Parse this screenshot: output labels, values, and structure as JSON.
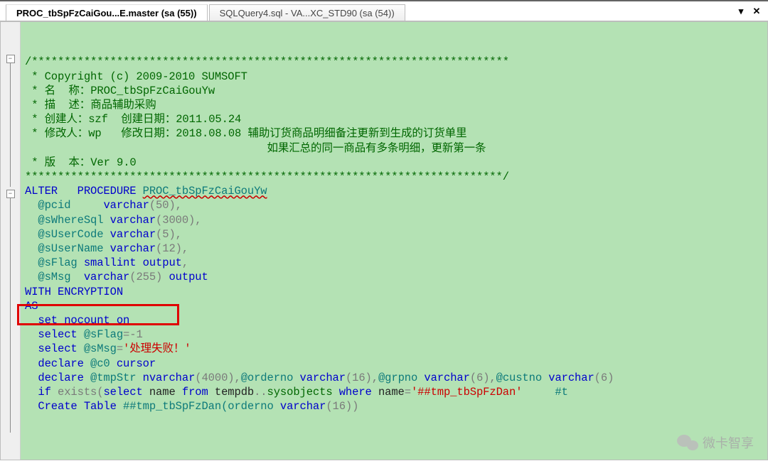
{
  "tabs": {
    "active": "PROC_tbSpFzCaiGou...E.master (sa (55))",
    "inactive": "SQLQuery4.sql - VA...XC_STD90 (sa (54))"
  },
  "winbtns": {
    "pin": "▾",
    "close": "✕"
  },
  "fold": {
    "glyph1": "−",
    "glyph2": "−"
  },
  "code": {
    "l01": "/*************************************************************************",
    "l02a": "* Copyright (c) 2009-2010 SUMSOFT",
    "l03a": "* 名  称：PROC_tbSpFzCaiGouYw",
    "l04a": "* 描  述：商品辅助采购",
    "l05a": "* 创建人：szf  创建日期：2011.05.24",
    "l06a": "* 修改人：wp   修改日期：2018.08.08 辅助订货商品明细备注更新到生成的订货单里",
    "l06b": "                                    如果汇总的同一商品有多条明细，更新第一条",
    "l07a": "* 版  本：Ver 9.0",
    "l08": "*************************************************************************/",
    "l09a": "ALTER",
    "l09b": "PROCEDURE",
    "l09c": "PROC_tbSpFzCaiGouYw",
    "l10a": "@pcid",
    "l10b": "varchar",
    "l10c": "(50),",
    "l11a": "@sWhereSql",
    "l11b": "varchar",
    "l11c": "(3000),",
    "l12a": "@sUserCode",
    "l12b": "varchar",
    "l12c": "(5),",
    "l13a": "@sUserName",
    "l13b": "varchar",
    "l13c": "(12),",
    "l14a": "@sFlag",
    "l14b": "smallint",
    "l14c": "output",
    "l14d": ",",
    "l15a": "@sMsg",
    "l15b": "varchar",
    "l15c": "(255)",
    "l15d": "output",
    "l16a": "WITH",
    "l16b": "ENCRYPTION",
    "l17a": "AS",
    "l18a": "set",
    "l18b": "nocount",
    "l18c": "on",
    "l19a": "select",
    "l19b": "@sFlag",
    "l19c": "=-1",
    "l20a": "select",
    "l20b": "@sMsg",
    "l20c": "=",
    "l20d": "'处理失败！'",
    "l21a": "declare",
    "l21b": "@c0",
    "l21c": "cursor",
    "l22a": "declare",
    "l22b": "@tmpStr",
    "l22c": "nvarchar",
    "l22d": "(4000),",
    "l22e": "@orderno",
    "l22f": "varchar",
    "l22g": "(16),",
    "l22h": "@grpno",
    "l22i": "varchar",
    "l22j": "(6),",
    "l22k": "@custno",
    "l22l": "varchar",
    "l22m": "(6)",
    "l23a": "if",
    "l23b": "exists",
    "l23c": "(",
    "l23d": "select",
    "l23e": "name",
    "l23f": "from",
    "l23g": "tempdb",
    "l23h": "..",
    "l23i": "sysobjects",
    "l23j": "where",
    "l23k": "name",
    "l23l": "=",
    "l23m": "'##tmp_tbSpFzDan'",
    "l23trail": "     #t",
    "l24a": "Create",
    "l24b": "Table",
    "l24c": "##tmp_tbSpFzDan(orderno",
    "l24d": "varchar",
    "l24e": "(16))"
  },
  "watermark": "微卡智享"
}
